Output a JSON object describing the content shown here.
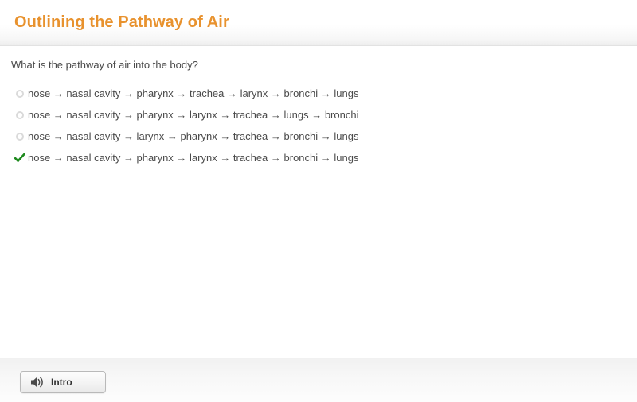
{
  "header": {
    "title": "Outlining the Pathway of Air",
    "title_color": "#e8922e"
  },
  "main": {
    "question": "What is the pathway of air into the body?",
    "options": [
      {
        "id": "option-1",
        "state": "unselected",
        "marker_icon": "radio-unchecked-icon",
        "text": "nose → nasal cavity → pharynx → trachea → larynx → bronchi → lungs"
      },
      {
        "id": "option-2",
        "state": "unselected",
        "marker_icon": "radio-unchecked-icon",
        "text": "nose → nasal cavity → pharynx → larynx → trachea → lungs → bronchi"
      },
      {
        "id": "option-3",
        "state": "unselected",
        "marker_icon": "radio-unchecked-icon",
        "text": "nose → nasal cavity → larynx → pharynx → trachea → bronchi → lungs"
      },
      {
        "id": "option-4",
        "state": "correct",
        "marker_icon": "green-check-icon",
        "text": "nose → nasal cavity → pharynx → larynx → trachea → bronchi → lungs"
      }
    ],
    "correct_color": "#1e8a1e",
    "radio_color": "#dadada"
  },
  "footer": {
    "intro_button": {
      "label": "Intro",
      "icon": "speaker-icon"
    }
  }
}
